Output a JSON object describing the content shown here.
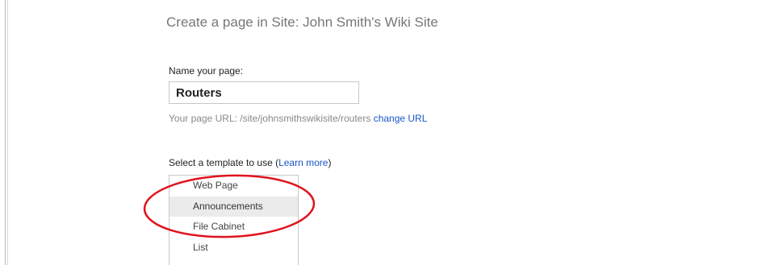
{
  "page_title": "Create a page in Site: John Smith's Wiki Site",
  "name_section": {
    "label": "Name your page:",
    "value": "Routers"
  },
  "url_line": {
    "prefix": "Your page URL: /site/johnsmithswikisite/routers",
    "change_link": "change URL"
  },
  "template_section": {
    "label_prefix": "Select a template to use (",
    "learn_more": "Learn more",
    "label_suffix": ")",
    "options": [
      "Web Page",
      "Announcements",
      "File Cabinet",
      "List"
    ],
    "selected": "Announcements"
  },
  "colors": {
    "link": "#1a55c8",
    "annotation": "#e0141e",
    "selected_bg": "#ebebeb"
  }
}
